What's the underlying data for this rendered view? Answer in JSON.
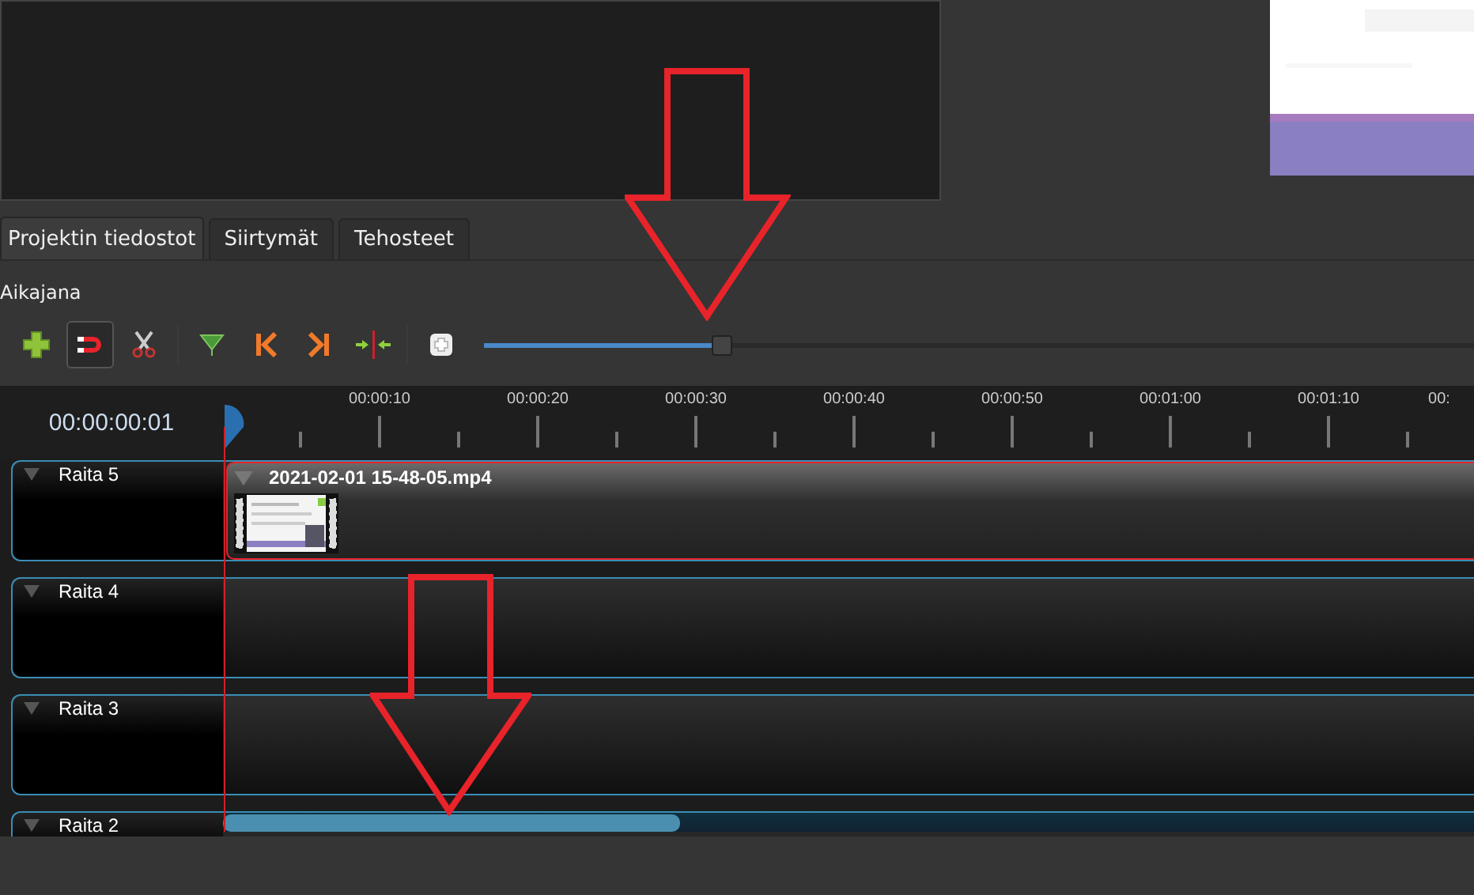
{
  "tabs": [
    {
      "label": "Projektin tiedostot",
      "selected": true
    },
    {
      "label": "Siirtymät",
      "selected": false
    },
    {
      "label": "Tehosteet",
      "selected": false
    }
  ],
  "timeline": {
    "title": "Aikajana",
    "snap": {
      "on": true
    },
    "zoom": {
      "level": 0.24
    },
    "timecode": "00:00:00:01",
    "ruler": [
      "00:00:10",
      "00:00:20",
      "00:00:30",
      "00:00:40",
      "00:00:50",
      "00:01:00",
      "00:01:10",
      "00:"
    ],
    "tracks": [
      {
        "name": "Raita 5",
        "clips": [
          {
            "name": "2021-02-01 15-48-05.mp4",
            "selected": true
          }
        ]
      },
      {
        "name": "Raita 4"
      },
      {
        "name": "Raita 3"
      },
      {
        "name": "Raita 2"
      }
    ]
  }
}
